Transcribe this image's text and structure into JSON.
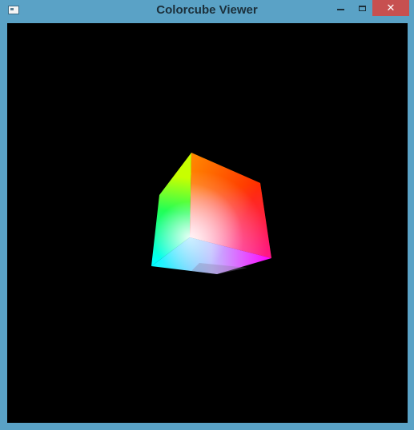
{
  "window": {
    "title": "Colorcube Viewer",
    "frame_color": "#5aa2c6",
    "close_button_color": "#c75050",
    "viewport_background": "#000000"
  },
  "icons": {
    "system_menu": "app-window-icon",
    "minimize": "minimize-icon",
    "maximize": "maximize-icon",
    "close": "close-icon"
  },
  "scene": {
    "object": "rgb-color-cube",
    "vertex_colors": {
      "top": "#ffff00",
      "left": "#22ff44",
      "back_right": "#ff2a00",
      "front_center": "#ffffff",
      "right": "#ff00ff",
      "bottom_left": "#00ffff",
      "bottom": "#b066c0"
    }
  }
}
